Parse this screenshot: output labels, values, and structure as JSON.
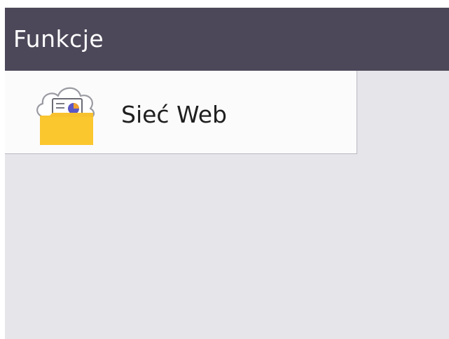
{
  "header": {
    "title": "Funkcje"
  },
  "menu": {
    "items": [
      {
        "label": "Sieć Web",
        "icon": "web-connect-icon"
      }
    ]
  },
  "colors": {
    "title_bar": "#4d4859",
    "background": "#e6e5ea",
    "item_background": "#fbfbfc",
    "folder": "#f8c22e"
  }
}
